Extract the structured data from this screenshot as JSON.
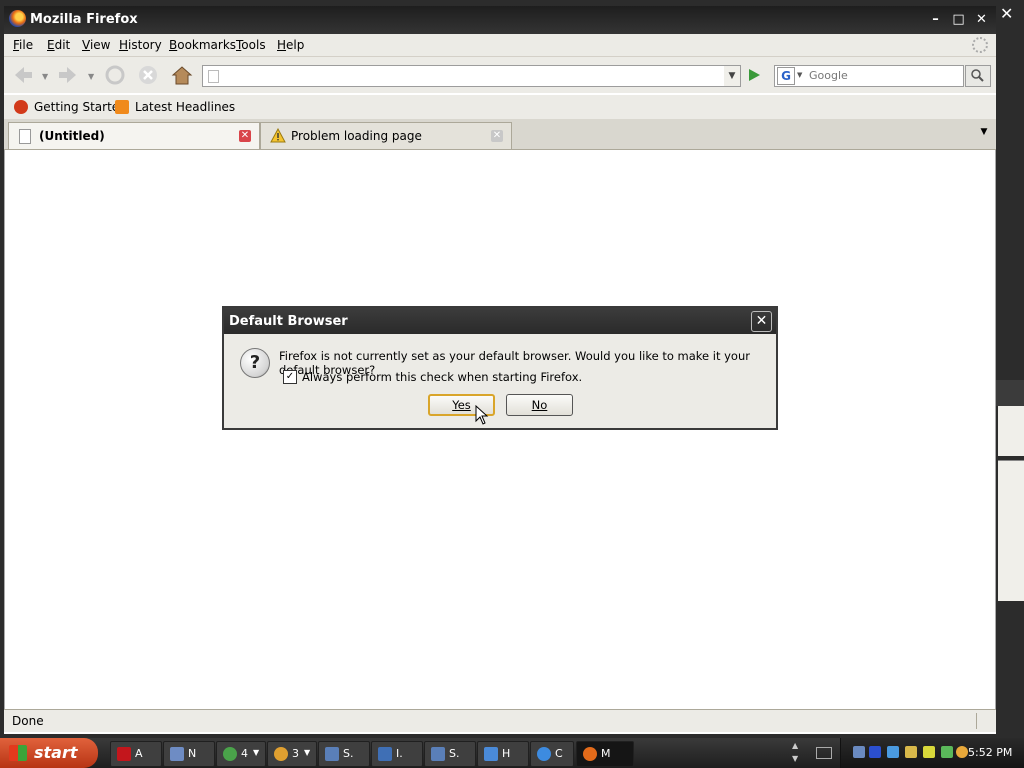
{
  "window": {
    "title": "Mozilla Firefox"
  },
  "menu": [
    "File",
    "Edit",
    "View",
    "History",
    "Bookmarks",
    "Tools",
    "Help"
  ],
  "menu_underline": [
    "F",
    "E",
    "V",
    "H",
    "B",
    "T",
    "H"
  ],
  "menu_rest": [
    "ile",
    "dit",
    "iew",
    "istory",
    "ookmarks",
    "ools",
    "elp"
  ],
  "navigation": {
    "url_value": "",
    "search_placeholder": "Google"
  },
  "bookmarks": [
    "Getting Started",
    "Latest Headlines"
  ],
  "tabs": [
    {
      "label": "(Untitled)",
      "active": true
    },
    {
      "label": "Problem loading page",
      "active": false
    }
  ],
  "status": {
    "text": "Done"
  },
  "dialog": {
    "title": "Default Browser",
    "message": "Firefox is not currently set as your default browser. Would you like to make it your default browser?",
    "checkbox_label": "Always perform this check when starting Firefox.",
    "checkbox_checked": true,
    "yes_label": "Yes",
    "no_label": "No",
    "checkmark": "✓",
    "question_mark": "?"
  },
  "taskbar": {
    "start_label": "start",
    "buttons": [
      {
        "label": "A",
        "icon": "acrobat-icon",
        "color": "#c3161c"
      },
      {
        "label": "N",
        "icon": "notepad-icon",
        "color": "#6e8cc4"
      },
      {
        "label": "4",
        "icon": "chrome-icon",
        "color": "#4aa34a"
      },
      {
        "label": "3",
        "icon": "paint-icon",
        "color": "#e0a030"
      },
      {
        "label": "S.",
        "icon": "app-icon",
        "color": "#5a7fb8"
      },
      {
        "label": "I.",
        "icon": "network-icon",
        "color": "#3f6fb5"
      },
      {
        "label": "S.",
        "icon": "app-icon",
        "color": "#5a7fb8"
      },
      {
        "label": "H",
        "icon": "help-icon",
        "color": "#4a8ad8"
      },
      {
        "label": "C",
        "icon": "ie-icon",
        "color": "#3d8be0"
      },
      {
        "label": "M",
        "icon": "firefox-icon",
        "color": "#e36b1a"
      }
    ],
    "clock": "5:52 PM"
  }
}
